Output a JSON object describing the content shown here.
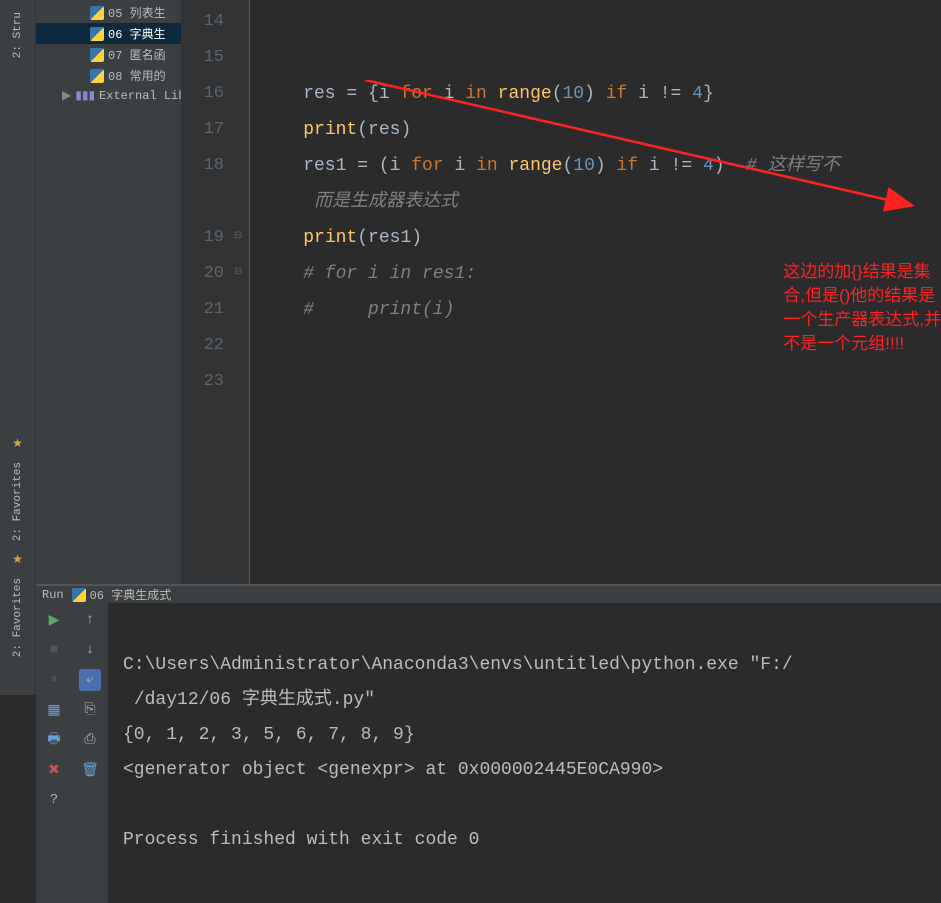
{
  "sidebar_verticals": {
    "structure": "2: Stru",
    "favorites": "2: Favorites",
    "favorites2": "2: Favorites"
  },
  "project_tree": {
    "item05": "05 列表生",
    "item06": "06 字典生",
    "item07": "07 匿名函",
    "item08": "08 常用的",
    "external": "External Libr"
  },
  "editor": {
    "line_numbers": [
      "14",
      "15",
      "16",
      "17",
      "18",
      "19",
      "20",
      "21",
      "22",
      "23"
    ],
    "lines": {
      "l14": "",
      "l15_pre": "    res = {i ",
      "l15_for": "for",
      "l15_mid1": " i ",
      "l15_in": "in",
      "l15_mid2": " ",
      "l15_range": "range",
      "l15_p1": "(",
      "l15_num1": "10",
      "l15_p2": ") ",
      "l15_if": "if",
      "l15_mid3": " i != ",
      "l15_num2": "4",
      "l15_end": "}",
      "l16_pre": "    ",
      "l16_print": "print",
      "l16_args": "(res)",
      "l17_pre": "    res1 = (i ",
      "l17_for": "for",
      "l17_mid1": " i ",
      "l17_in": "in",
      "l17_mid2": " ",
      "l17_range": "range",
      "l17_p1": "(",
      "l17_num1": "10",
      "l17_p2": ") ",
      "l17_if": "if",
      "l17_mid3": " i != ",
      "l17_num2": "4",
      "l17_end": ")  ",
      "l17_comment": "# 这样写不",
      "l17b_comment": "     而是生成器表达式",
      "l18_pre": "    ",
      "l18_print": "print",
      "l18_args": "(res1)",
      "l19_comment": "    # for i in res1:",
      "l20_comment": "    #     print(i)"
    },
    "annotation": {
      "line1": "这边的加{}结果是集",
      "line2": "合,但是()他的结果是",
      "line3": "一个生产器表达式,并",
      "line4": "不是一个元组!!!!"
    }
  },
  "run_panel": {
    "title_prefix": "Run",
    "title_file": "06 字典生成式",
    "console_lines": {
      "cmd": "C:\\Users\\Administrator\\Anaconda3\\envs\\untitled\\python.exe \"F:/",
      "cmd2": " /day12/06 字典生成式.py\"",
      "out1": "{0, 1, 2, 3, 5, 6, 7, 8, 9}",
      "out2": "<generator object <genexpr> at 0x000002445E0CA990>",
      "blank": "",
      "exit": "Process finished with exit code 0"
    }
  }
}
